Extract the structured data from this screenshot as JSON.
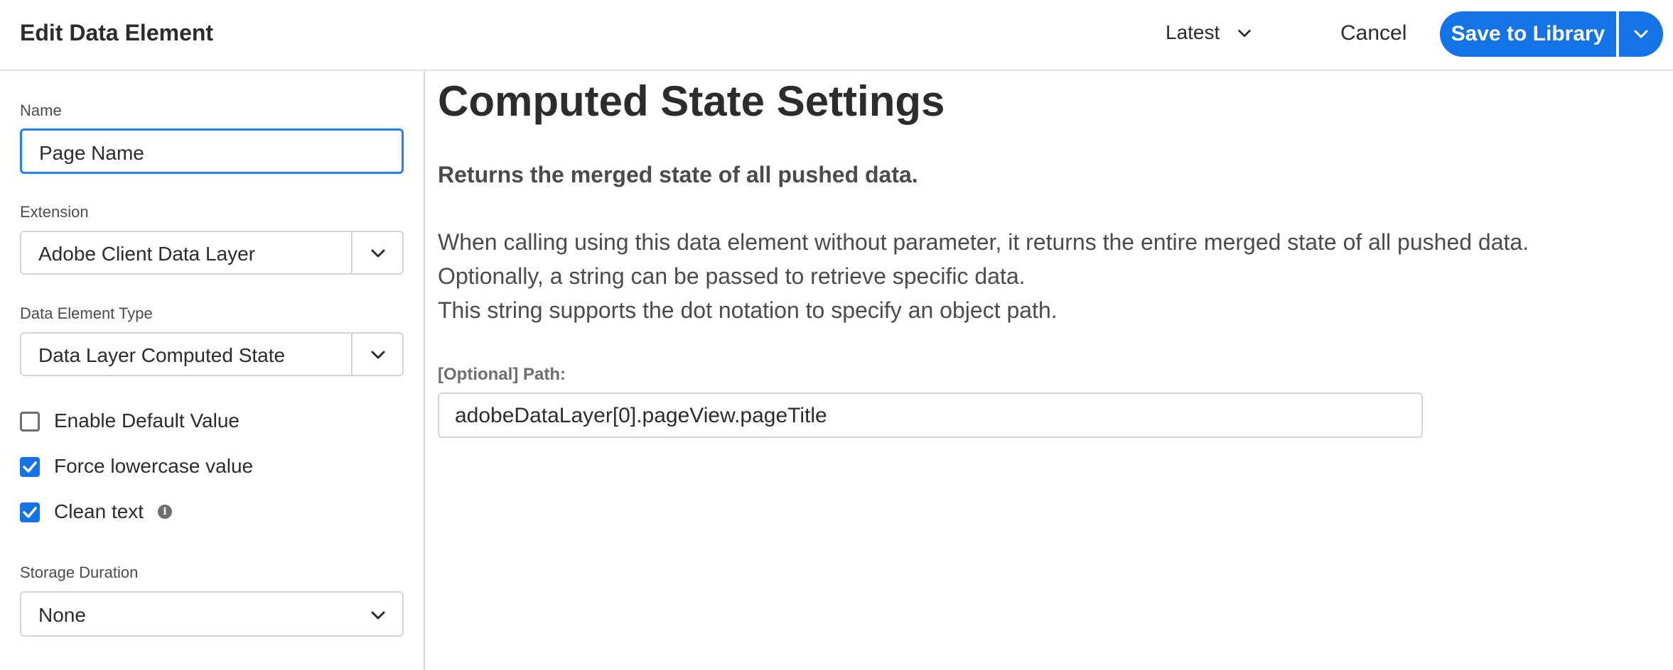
{
  "header": {
    "title": "Edit Data Element",
    "version": "Latest",
    "cancel": "Cancel",
    "save": "Save to Library"
  },
  "form": {
    "name_label": "Name",
    "name_value": "Page Name",
    "extension_label": "Extension",
    "extension_value": "Adobe Client Data Layer",
    "type_label": "Data Element Type",
    "type_value": "Data Layer Computed State",
    "checkboxes": [
      {
        "label": "Enable Default Value",
        "checked": false
      },
      {
        "label": "Force lowercase value",
        "checked": true
      },
      {
        "label": "Clean text",
        "checked": true
      }
    ],
    "storage_label": "Storage Duration",
    "storage_value": "None"
  },
  "settings": {
    "heading": "Computed State Settings",
    "subheading": "Returns the merged state of all pushed data.",
    "lines": [
      "When calling using this data element without parameter, it returns the entire merged state of all pushed data.",
      "Optionally, a string can be passed to retrieve specific data.",
      "This string supports the dot notation to specify an object path."
    ],
    "path_label": "[Optional] Path:",
    "path_value": "adobeDataLayer[0].pageView.pageTitle"
  },
  "colors": {
    "accent": "#1473e6",
    "focus_border": "#2680eb"
  },
  "icons": {
    "version_dropdown": "chevron-down-icon",
    "save_menu": "chevron-down-icon",
    "clean_text_info": "info-icon",
    "checkbox_checked": "checkmark-icon"
  }
}
